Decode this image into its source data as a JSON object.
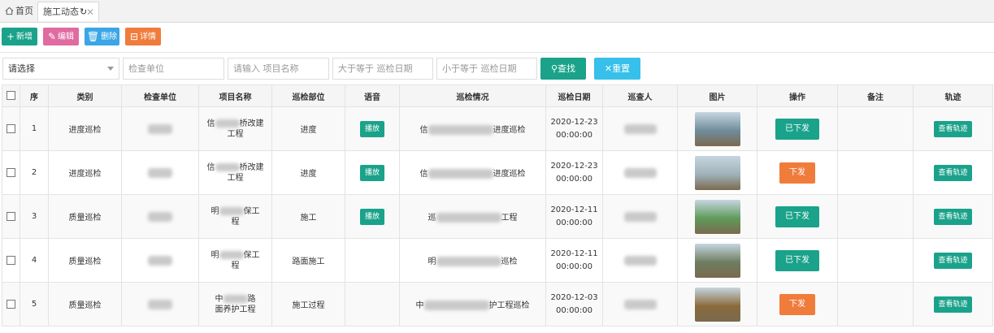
{
  "tabs": {
    "home": "首页",
    "active": "施工动态"
  },
  "toolbar": {
    "add": "新增",
    "edit": "编辑",
    "delete": "删除",
    "detail": "详情"
  },
  "filters": {
    "select": "请选择",
    "unit_placeholder": "检查单位",
    "project_placeholder": "请输入 项目名称",
    "date_from_placeholder": "大于等于 巡检日期",
    "date_to_placeholder": "小于等于 巡检日期",
    "search": "查找",
    "reset": "重置"
  },
  "columns": [
    "序",
    "类别",
    "检查单位",
    "项目名称",
    "巡检部位",
    "语音",
    "巡检情况",
    "巡检日期",
    "巡查人",
    "图片",
    "操作",
    "备注",
    "轨迹"
  ],
  "labels": {
    "play": "播放",
    "track": "查看轨迹"
  },
  "rows": [
    {
      "no": "1",
      "category": "进度巡检",
      "project": [
        "信",
        "桥改建",
        "工程"
      ],
      "part": "进度",
      "voice": true,
      "situation": [
        "信",
        "进度巡检"
      ],
      "date": "2020-12-23",
      "time": "00:00:00",
      "status": "已下发",
      "status_color": "#1aa28a",
      "thumb": "#6f8c9a"
    },
    {
      "no": "2",
      "category": "进度巡检",
      "project": [
        "信",
        "桥改建",
        "工程"
      ],
      "part": "进度",
      "voice": true,
      "situation": [
        "信",
        "进度巡检"
      ],
      "date": "2020-12-23",
      "time": "00:00:00",
      "status": "下发",
      "status_color": "#f07c3c",
      "thumb": "#9fb0b8"
    },
    {
      "no": "3",
      "category": "质量巡检",
      "project": [
        "明",
        "保工",
        "程"
      ],
      "part": "施工",
      "voice": true,
      "situation": [
        "巡",
        "工程"
      ],
      "date": "2020-12-11",
      "time": "00:00:00",
      "status": "已下发",
      "status_color": "#1aa28a",
      "thumb": "#5f9a5a"
    },
    {
      "no": "4",
      "category": "质量巡检",
      "project": [
        "明",
        "保工",
        "程"
      ],
      "part": "路面施工",
      "voice": false,
      "situation": [
        "明",
        "巡检"
      ],
      "date": "2020-12-11",
      "time": "00:00:00",
      "status": "已下发",
      "status_color": "#1aa28a",
      "thumb": "#6d7d60"
    },
    {
      "no": "5",
      "category": "质量巡检",
      "project": [
        "中",
        "路",
        "面养护工程"
      ],
      "part": "施工过程",
      "voice": false,
      "situation": [
        "中",
        "护工程巡检"
      ],
      "date": "2020-12-03",
      "time": "00:00:00",
      "status": "下发",
      "status_color": "#f07c3c",
      "thumb": "#8a6a3a"
    }
  ]
}
